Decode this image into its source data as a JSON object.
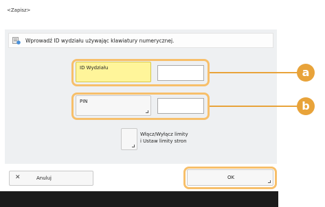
{
  "header": {
    "title": "<Zapisz>"
  },
  "message": {
    "text": "Wprowadź ID wydziału używając klawiatury numerycznej."
  },
  "fields": {
    "department_id": {
      "label": "ID Wydziału",
      "value": ""
    },
    "pin": {
      "label": "PIN",
      "value": ""
    }
  },
  "limits_button": {
    "line1": "Włącz/Wyłącz limity",
    "line2": "i Ustaw limity stron"
  },
  "footer": {
    "cancel_label": "Anuluj",
    "ok_label": "OK"
  },
  "callouts": {
    "a": "a",
    "b": "b"
  },
  "colors": {
    "highlight": "#f7bf6a",
    "callout": "#e8a33a",
    "active_button": "#fff59a",
    "panel": "#eef0f2"
  },
  "icons": [
    "message-info-icon",
    "close-icon",
    "corner-arrow-icon"
  ]
}
